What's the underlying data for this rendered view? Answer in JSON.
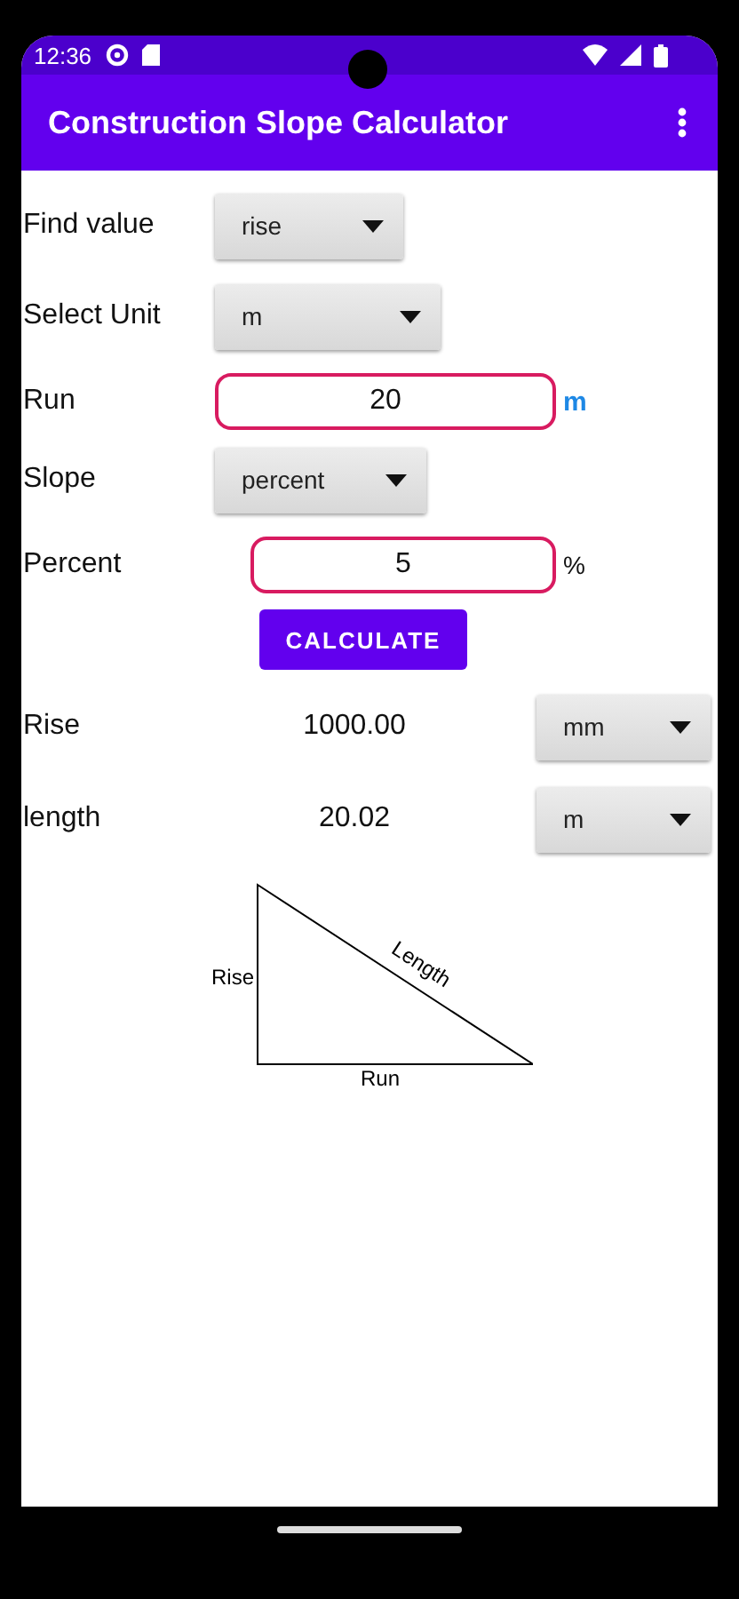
{
  "status_bar": {
    "time": "12:36"
  },
  "app_bar": {
    "title": "Construction Slope Calculator"
  },
  "fields": [
    {
      "kind": "dropdown",
      "label": "Find value",
      "value": "rise"
    },
    {
      "kind": "dropdown",
      "label": "Select Unit",
      "value": "m"
    },
    {
      "kind": "input",
      "label": "Run",
      "value": "20",
      "unit": "m",
      "highlighted": true
    },
    {
      "kind": "dropdown",
      "label": "Slope",
      "value": "percent"
    },
    {
      "kind": "input",
      "label": "Percent",
      "value": "5",
      "unit": "%",
      "highlighted": false
    }
  ],
  "calculate_button": "CALCULATE",
  "results": [
    {
      "label": "Rise",
      "value": "1000.00",
      "unit": "mm"
    },
    {
      "label": "length",
      "value": "20.02",
      "unit": "m"
    }
  ],
  "diagram": {
    "rise": "Rise",
    "length": "Length",
    "run": "Run"
  }
}
